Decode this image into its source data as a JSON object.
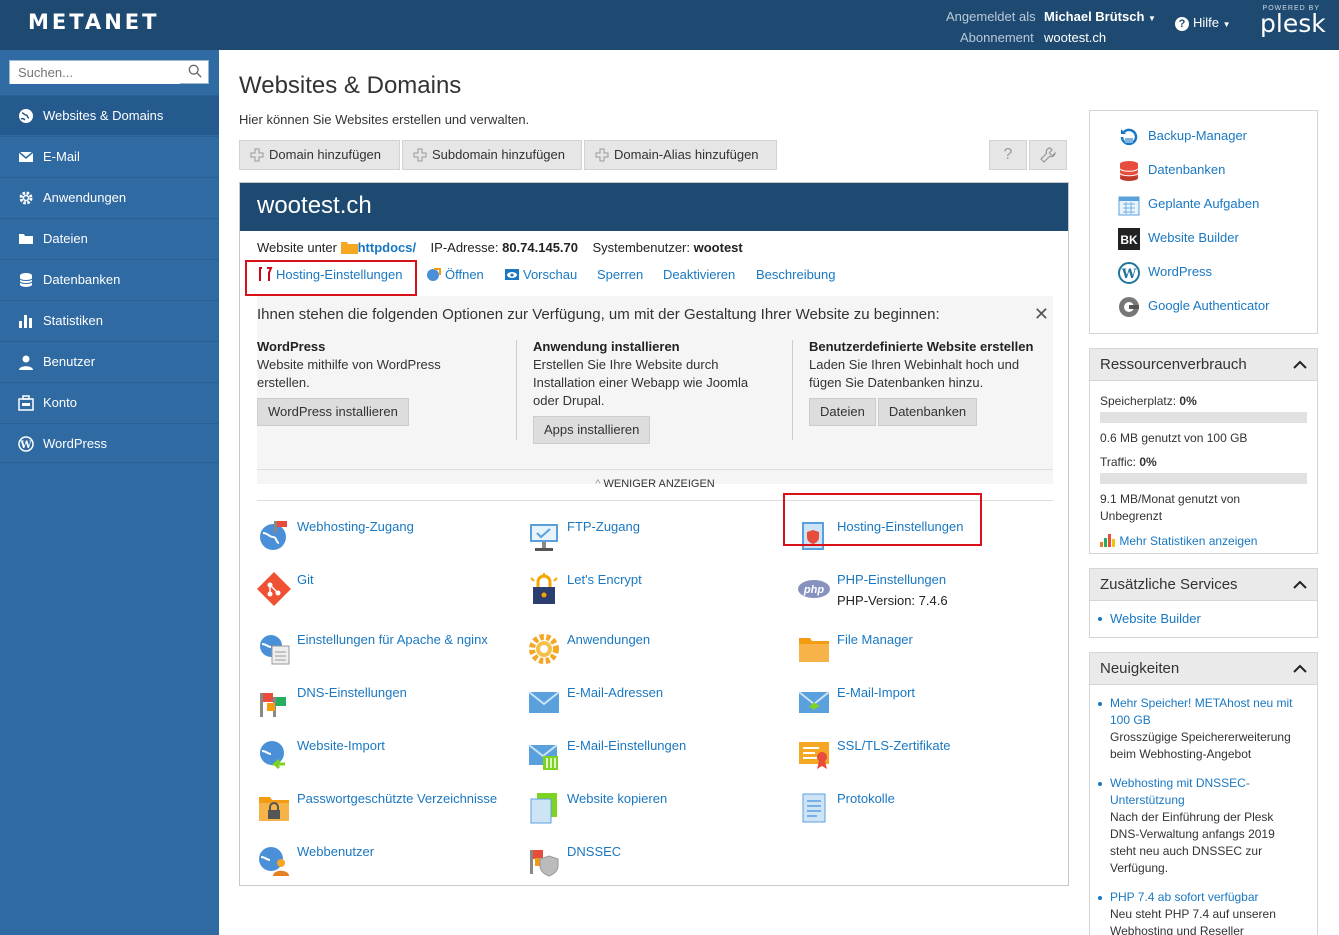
{
  "header": {
    "logo": "METANET",
    "logged_label": "Angemeldet als",
    "user": "Michael Brütsch",
    "subscription_label": "Abonnement",
    "subscription": "wootest.ch",
    "help": "Hilfe",
    "powered_by": "POWERED BY",
    "plesk": "plesk"
  },
  "sidebar": {
    "search_placeholder": "Suchen...",
    "items": [
      {
        "label": "Websites & Domains",
        "icon": "globe-icon"
      },
      {
        "label": "E-Mail",
        "icon": "mail-icon"
      },
      {
        "label": "Anwendungen",
        "icon": "gear-icon"
      },
      {
        "label": "Dateien",
        "icon": "folder-icon"
      },
      {
        "label": "Datenbanken",
        "icon": "database-icon"
      },
      {
        "label": "Statistiken",
        "icon": "bar-chart-icon"
      },
      {
        "label": "Benutzer",
        "icon": "user-icon"
      },
      {
        "label": "Konto",
        "icon": "briefcase-icon"
      },
      {
        "label": "WordPress",
        "icon": "wordpress-icon"
      }
    ]
  },
  "main": {
    "title": "Websites & Domains",
    "description": "Hier können Sie Websites erstellen und verwalten.",
    "toolbar": [
      "Domain hinzufügen",
      "Subdomain hinzufügen",
      "Domain-Alias hinzufügen"
    ],
    "help_btn": "?",
    "domain": {
      "name": "wootest.ch",
      "website_label": "Website unter",
      "httpdocs": "httpdocs/",
      "ip_label": "IP-Adresse:",
      "ip": "80.74.145.70",
      "sysuser_label": "Systembenutzer:",
      "sysuser": "wootest",
      "actions": [
        "Hosting-Einstellungen",
        "Öffnen",
        "Vorschau",
        "Sperren",
        "Deaktivieren",
        "Beschreibung"
      ]
    },
    "promo": {
      "heading": "Ihnen stehen die folgenden Optionen zur Verfügung, um mit der Gestaltung Ihrer Website zu beginnen:",
      "cols": [
        {
          "title": "WordPress",
          "desc": "Website mithilfe von WordPress erstellen.",
          "buttons": [
            "WordPress installieren"
          ]
        },
        {
          "title": "Anwendung installieren",
          "desc": "Erstellen Sie Ihre Website durch Installation einer Webapp wie Joomla oder Drupal.",
          "buttons": [
            "Apps installieren"
          ]
        },
        {
          "title": "Benutzerdefinierte Website erstellen",
          "desc": "Laden Sie Ihren Webinhalt hoch und fügen Sie Datenbanken hinzu.",
          "buttons": [
            "Dateien",
            "Datenbanken"
          ]
        }
      ],
      "less": "WENIGER ANZEIGEN"
    },
    "tools": [
      {
        "label": "Webhosting-Zugang",
        "icon": "web-hosting-access-icon"
      },
      {
        "label": "FTP-Zugang",
        "icon": "ftp-icon"
      },
      {
        "label": "Hosting-Einstellungen",
        "icon": "hosting-settings-icon"
      },
      {
        "label": "Git",
        "icon": "git-icon"
      },
      {
        "label": "Let's Encrypt",
        "icon": "lets-encrypt-icon"
      },
      {
        "label": "PHP-Einstellungen",
        "sub": "PHP-Version: 7.4.6",
        "icon": "php-icon"
      },
      {
        "label": "Einstellungen für Apache & nginx",
        "icon": "apache-nginx-icon"
      },
      {
        "label": "Anwendungen",
        "icon": "applications-gear-icon"
      },
      {
        "label": "File Manager",
        "icon": "file-manager-icon"
      },
      {
        "label": "DNS-Einstellungen",
        "icon": "dns-icon"
      },
      {
        "label": "E-Mail-Adressen",
        "icon": "email-addresses-icon"
      },
      {
        "label": "E-Mail-Import",
        "icon": "email-import-icon"
      },
      {
        "label": "Website-Import",
        "icon": "website-import-icon"
      },
      {
        "label": "E-Mail-Einstellungen",
        "icon": "email-settings-icon"
      },
      {
        "label": "SSL/TLS-Zertifikate",
        "icon": "ssl-certificate-icon"
      },
      {
        "label": "Passwortgeschützte Verzeichnisse",
        "icon": "protected-folder-icon"
      },
      {
        "label": "Website kopieren",
        "icon": "copy-website-icon"
      },
      {
        "label": "Protokolle",
        "icon": "logs-icon"
      },
      {
        "label": "Webbenutzer",
        "icon": "web-users-icon"
      },
      {
        "label": "DNSSEC",
        "icon": "dnssec-icon"
      }
    ]
  },
  "right": {
    "links": [
      {
        "label": "Backup-Manager",
        "icon": "backup-icon"
      },
      {
        "label": "Datenbanken",
        "icon": "database-icon"
      },
      {
        "label": "Geplante Aufgaben",
        "icon": "calendar-icon"
      },
      {
        "label": "Website Builder",
        "icon": "website-builder-icon"
      },
      {
        "label": "WordPress",
        "icon": "wordpress-icon"
      },
      {
        "label": "Google Authenticator",
        "icon": "google-authenticator-icon"
      }
    ],
    "resources": {
      "title": "Ressourcenverbrauch",
      "disk_label": "Speicherplatz:",
      "disk_pct": "0%",
      "disk_usage": "0.6 MB genutzt von 100 GB",
      "traffic_label": "Traffic:",
      "traffic_pct": "0%",
      "traffic_usage": "9.1 MB/Monat genutzt von Unbegrenzt",
      "more": "Mehr Statistiken anzeigen"
    },
    "services": {
      "title": "Zusätzliche Services",
      "items": [
        "Website Builder"
      ]
    },
    "news": {
      "title": "Neuigkeiten",
      "items": [
        {
          "title": "Mehr Speicher! METAhost neu mit 100 GB",
          "text": "Grosszügige Speichererweiterung beim Webhosting-Angebot"
        },
        {
          "title": "Webhosting mit DNSSEC-Unterstützung",
          "text": "Nach der Einführung der Plesk DNS-Verwaltung anfangs 2019 steht neu auch DNSSEC zur Verfügung."
        },
        {
          "title": "PHP 7.4 ab sofort verfügbar",
          "text": "Neu steht PHP 7.4 auf unseren Webhosting und Reseller"
        }
      ]
    }
  }
}
